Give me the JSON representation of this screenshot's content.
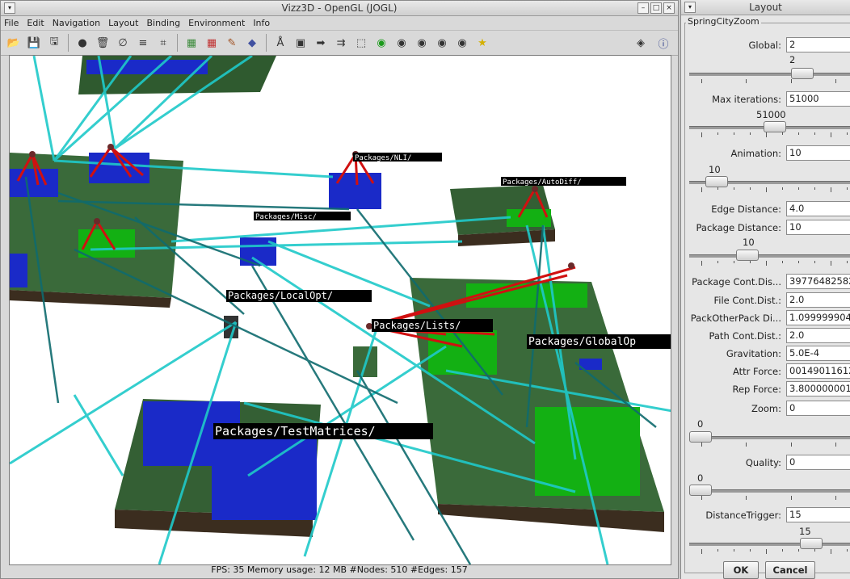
{
  "main_window": {
    "title": "Vizz3D - OpenGL (JOGL)",
    "menu": [
      "File",
      "Edit",
      "Navigation",
      "Layout",
      "Binding",
      "Environment",
      "Info"
    ],
    "status": "FPS: 35   Memory usage: 12 MB  #Nodes: 510 #Edges: 157"
  },
  "toolbar": {
    "groups": [
      [
        "open-folder-icon",
        "save-icon",
        "save-as-icon"
      ],
      [
        "sphere-icon",
        "trash-icon",
        "lasso-icon",
        "layout-icon",
        "fit-view-icon"
      ],
      [
        "grid-icon",
        "grid-red-icon",
        "paint-icon",
        "bucket-icon"
      ],
      [
        "person-icon",
        "text-box-icon",
        "arrow-right-icon",
        "arrows-icon",
        "selection-icon",
        "green-circle-icon",
        "eye-icon",
        "eye-icon",
        "eye-icon",
        "eye-icon",
        "star-icon"
      ]
    ],
    "right_icons": [
      "diamond-icon",
      "info-icon"
    ]
  },
  "scene": {
    "labels": [
      "Packages/NLI/",
      "Packages/AutoDiff/",
      "Packages/Misc/",
      "Packages/LocalOpt/",
      "Packages/Lists/",
      "Packages/GlobalOp",
      "Packages/TestMatrices/"
    ],
    "colors": {
      "edge_cyan": "#1fc9c9",
      "edge_dark": "#0f6b6e",
      "edge_red": "#d01010",
      "plane_green": "#2f5a2f",
      "block_blue": "#1a2ac8",
      "block_green": "#13b013"
    }
  },
  "layout_panel": {
    "title": "Layout",
    "group": "SpringCityZoom",
    "global_label": "Global:",
    "global_value": "2",
    "global_slider_label": "2",
    "max_iter_label": "Max iterations:",
    "max_iter_value": "51000",
    "max_iter_slider_label": "51000",
    "animation_label": "Animation:",
    "animation_value": "10",
    "animation_slider_label": "10",
    "edge_distance_label": "Edge Distance:",
    "edge_distance_value": "4.0",
    "package_distance_label": "Package Distance:",
    "package_distance_value": "10",
    "package_distance_slider_label": "10",
    "package_cont_label": "Package Cont.Dis...",
    "package_cont_value": "39776482582",
    "file_cont_label": "File Cont.Dist.:",
    "file_cont_value": "2.0",
    "packother_label": "PackOtherPack Di...",
    "packother_value": "1.0999999046",
    "path_cont_label": "Path Cont.Dist.:",
    "path_cont_value": "2.0",
    "gravitation_label": "Gravitation:",
    "gravitation_value": "5.0E-4",
    "attr_force_label": "Attr Force:",
    "attr_force_value": "00149011612",
    "rep_force_label": "Rep Force:",
    "rep_force_value": "3.800000001",
    "zoom_label": "Zoom:",
    "zoom_value": "0",
    "zoom_slider_label": "0",
    "quality_label": "Quality:",
    "quality_value": "0",
    "quality_slider_label": "0",
    "distance_trigger_label": "DistanceTrigger:",
    "distance_trigger_value": "15",
    "distance_trigger_slider_label": "15",
    "ok_label": "OK",
    "cancel_label": "Cancel"
  }
}
